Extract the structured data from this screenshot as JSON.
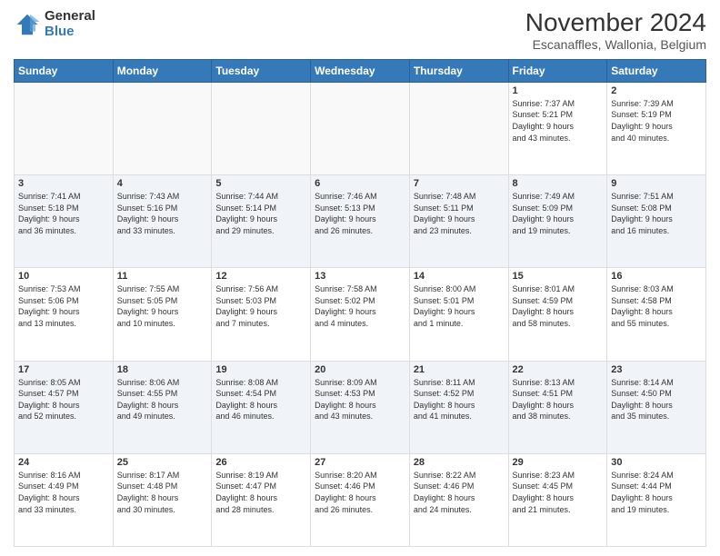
{
  "header": {
    "logo": {
      "general": "General",
      "blue": "Blue"
    },
    "title": "November 2024",
    "subtitle": "Escanaffles, Wallonia, Belgium"
  },
  "calendar": {
    "days_of_week": [
      "Sunday",
      "Monday",
      "Tuesday",
      "Wednesday",
      "Thursday",
      "Friday",
      "Saturday"
    ],
    "weeks": [
      [
        {
          "day": "",
          "info": ""
        },
        {
          "day": "",
          "info": ""
        },
        {
          "day": "",
          "info": ""
        },
        {
          "day": "",
          "info": ""
        },
        {
          "day": "",
          "info": ""
        },
        {
          "day": "1",
          "info": "Sunrise: 7:37 AM\nSunset: 5:21 PM\nDaylight: 9 hours\nand 43 minutes."
        },
        {
          "day": "2",
          "info": "Sunrise: 7:39 AM\nSunset: 5:19 PM\nDaylight: 9 hours\nand 40 minutes."
        }
      ],
      [
        {
          "day": "3",
          "info": "Sunrise: 7:41 AM\nSunset: 5:18 PM\nDaylight: 9 hours\nand 36 minutes."
        },
        {
          "day": "4",
          "info": "Sunrise: 7:43 AM\nSunset: 5:16 PM\nDaylight: 9 hours\nand 33 minutes."
        },
        {
          "day": "5",
          "info": "Sunrise: 7:44 AM\nSunset: 5:14 PM\nDaylight: 9 hours\nand 29 minutes."
        },
        {
          "day": "6",
          "info": "Sunrise: 7:46 AM\nSunset: 5:13 PM\nDaylight: 9 hours\nand 26 minutes."
        },
        {
          "day": "7",
          "info": "Sunrise: 7:48 AM\nSunset: 5:11 PM\nDaylight: 9 hours\nand 23 minutes."
        },
        {
          "day": "8",
          "info": "Sunrise: 7:49 AM\nSunset: 5:09 PM\nDaylight: 9 hours\nand 19 minutes."
        },
        {
          "day": "9",
          "info": "Sunrise: 7:51 AM\nSunset: 5:08 PM\nDaylight: 9 hours\nand 16 minutes."
        }
      ],
      [
        {
          "day": "10",
          "info": "Sunrise: 7:53 AM\nSunset: 5:06 PM\nDaylight: 9 hours\nand 13 minutes."
        },
        {
          "day": "11",
          "info": "Sunrise: 7:55 AM\nSunset: 5:05 PM\nDaylight: 9 hours\nand 10 minutes."
        },
        {
          "day": "12",
          "info": "Sunrise: 7:56 AM\nSunset: 5:03 PM\nDaylight: 9 hours\nand 7 minutes."
        },
        {
          "day": "13",
          "info": "Sunrise: 7:58 AM\nSunset: 5:02 PM\nDaylight: 9 hours\nand 4 minutes."
        },
        {
          "day": "14",
          "info": "Sunrise: 8:00 AM\nSunset: 5:01 PM\nDaylight: 9 hours\nand 1 minute."
        },
        {
          "day": "15",
          "info": "Sunrise: 8:01 AM\nSunset: 4:59 PM\nDaylight: 8 hours\nand 58 minutes."
        },
        {
          "day": "16",
          "info": "Sunrise: 8:03 AM\nSunset: 4:58 PM\nDaylight: 8 hours\nand 55 minutes."
        }
      ],
      [
        {
          "day": "17",
          "info": "Sunrise: 8:05 AM\nSunset: 4:57 PM\nDaylight: 8 hours\nand 52 minutes."
        },
        {
          "day": "18",
          "info": "Sunrise: 8:06 AM\nSunset: 4:55 PM\nDaylight: 8 hours\nand 49 minutes."
        },
        {
          "day": "19",
          "info": "Sunrise: 8:08 AM\nSunset: 4:54 PM\nDaylight: 8 hours\nand 46 minutes."
        },
        {
          "day": "20",
          "info": "Sunrise: 8:09 AM\nSunset: 4:53 PM\nDaylight: 8 hours\nand 43 minutes."
        },
        {
          "day": "21",
          "info": "Sunrise: 8:11 AM\nSunset: 4:52 PM\nDaylight: 8 hours\nand 41 minutes."
        },
        {
          "day": "22",
          "info": "Sunrise: 8:13 AM\nSunset: 4:51 PM\nDaylight: 8 hours\nand 38 minutes."
        },
        {
          "day": "23",
          "info": "Sunrise: 8:14 AM\nSunset: 4:50 PM\nDaylight: 8 hours\nand 35 minutes."
        }
      ],
      [
        {
          "day": "24",
          "info": "Sunrise: 8:16 AM\nSunset: 4:49 PM\nDaylight: 8 hours\nand 33 minutes."
        },
        {
          "day": "25",
          "info": "Sunrise: 8:17 AM\nSunset: 4:48 PM\nDaylight: 8 hours\nand 30 minutes."
        },
        {
          "day": "26",
          "info": "Sunrise: 8:19 AM\nSunset: 4:47 PM\nDaylight: 8 hours\nand 28 minutes."
        },
        {
          "day": "27",
          "info": "Sunrise: 8:20 AM\nSunset: 4:46 PM\nDaylight: 8 hours\nand 26 minutes."
        },
        {
          "day": "28",
          "info": "Sunrise: 8:22 AM\nSunset: 4:46 PM\nDaylight: 8 hours\nand 24 minutes."
        },
        {
          "day": "29",
          "info": "Sunrise: 8:23 AM\nSunset: 4:45 PM\nDaylight: 8 hours\nand 21 minutes."
        },
        {
          "day": "30",
          "info": "Sunrise: 8:24 AM\nSunset: 4:44 PM\nDaylight: 8 hours\nand 19 minutes."
        }
      ]
    ]
  }
}
